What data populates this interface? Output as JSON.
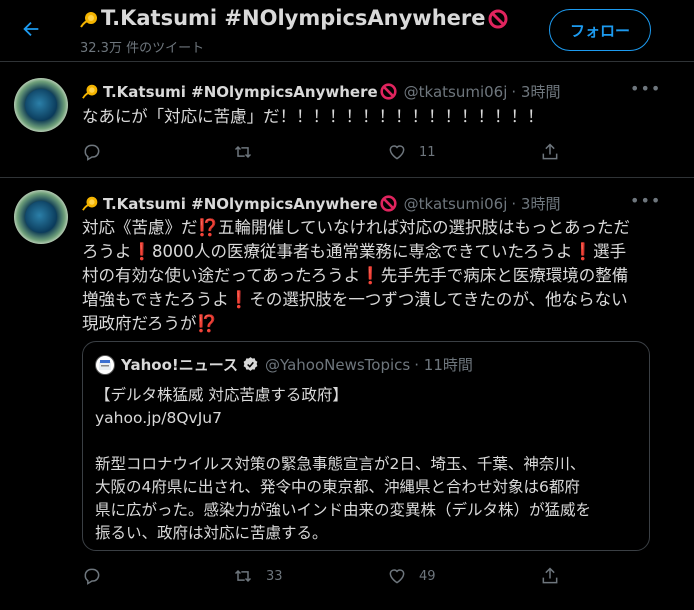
{
  "header": {
    "back_icon": "arrow-left-icon",
    "title": "T.Katsumi #NOlympicsAnywhere",
    "subtitle": "32.3万 件のツイート",
    "follow_label": "フォロー",
    "accent": "#1d9bf0"
  },
  "tweets": [
    {
      "name": "T.Katsumi #NOlympicsAnywhere",
      "handle": "@tkatsumi06j",
      "time": "· 3時間",
      "text": [
        "なあにが「対応に苦慮」だ！！！！！！！！！！！！！！！！"
      ],
      "reply_count": "",
      "retweet_count": "",
      "like_count": "11"
    },
    {
      "name": "T.Katsumi #NOlympicsAnywhere",
      "handle": "@tkatsumi06j",
      "time": "· 3時間",
      "text": [
        "対応《苦慮》だ⁉️五輪開催していなければ対応の選択肢はもっとあっただ",
        "ろうよ❗️8000人の医療従事者も通常業務に専念できていたろうよ❗️選手",
        "村の有効な使い途だってあったろうよ❗️先手先手で病床と医療環境の整備",
        "増強もできたろうよ❗️その選択肢を一つずつ潰してきたのが、他ならない",
        "現政府だろうが⁉️"
      ],
      "quote": {
        "name": "Yahoo!ニュース",
        "handle": "@YahooNewsTopics",
        "time": "· 11時間",
        "title": "【デルタ株猛威 対応苦慮する政府】",
        "link": "yahoo.jp/8QvJu7",
        "body": [
          "新型コロナウイルス対策の緊急事態宣言が2日、埼玉、千葉、神奈川、",
          "大阪の4府県に出され、発令中の東京都、沖縄県と合わせ対象は6都府",
          "県に広がった。感染力が強いインド由来の変異株（デルタ株）が猛威を",
          "振るい、政府は対応に苦慮する。"
        ]
      },
      "reply_count": "",
      "retweet_count": "33",
      "like_count": "49"
    }
  ],
  "icons": {
    "more": "more-icon",
    "reply": "reply-icon",
    "retweet": "retweet-icon",
    "like": "heart-icon",
    "share": "share-icon",
    "verified": "verified-badge-icon",
    "emoji_name_prefix": "sun-emoji-icon",
    "emoji_name_suffix": "no-entry-emoji-icon"
  },
  "colors": {
    "background": "#000000",
    "text": "#d9d9d9",
    "muted": "#6e767d",
    "border": "#2f3336"
  }
}
